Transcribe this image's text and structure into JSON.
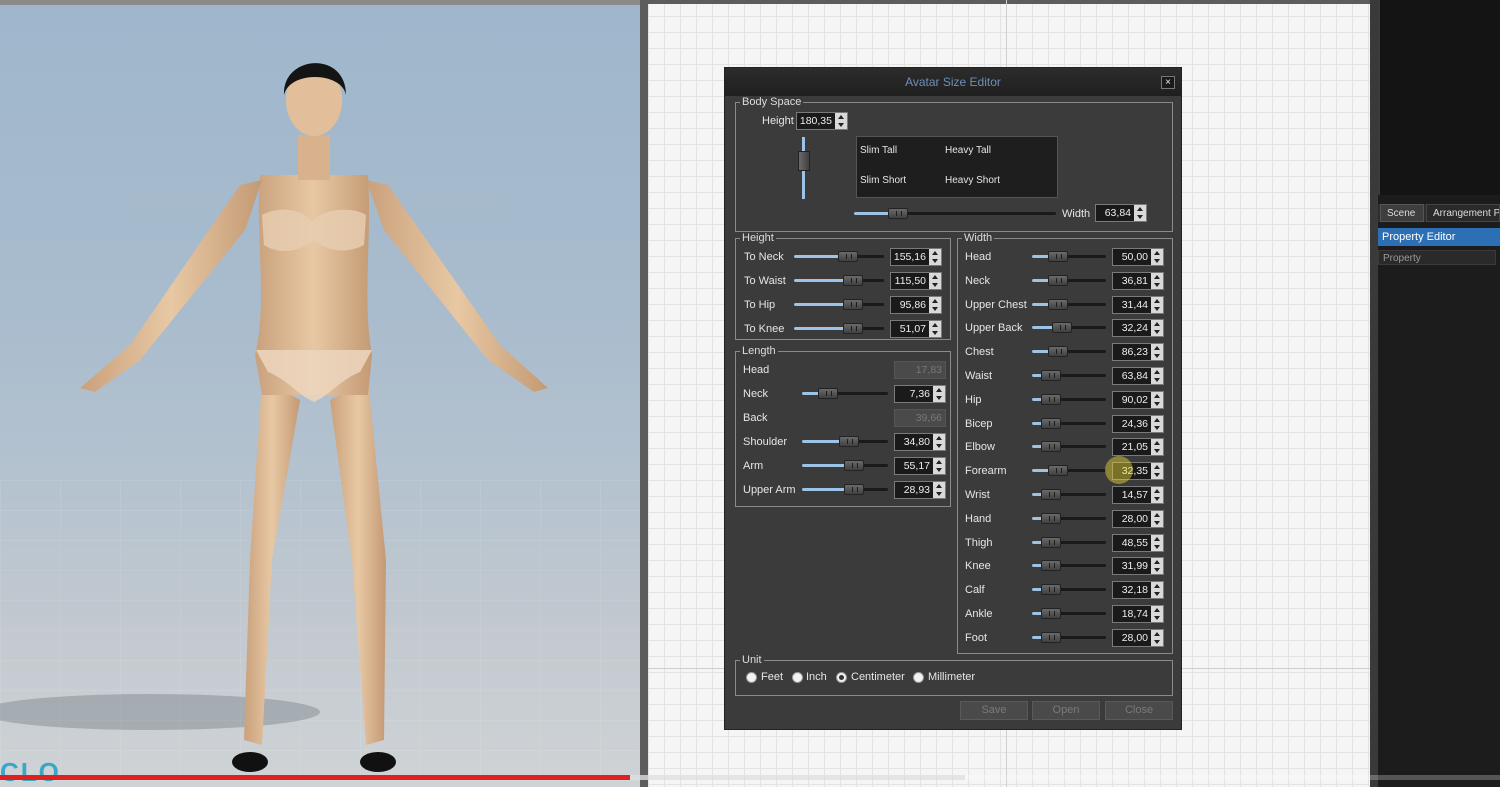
{
  "dialog": {
    "title": "Avatar Size Editor",
    "close_label": "×",
    "body_space": {
      "label": "Body Space",
      "height_label": "Height",
      "height_value": "180,35",
      "presets": [
        "Slim Tall",
        "Heavy Tall",
        "Slim Short",
        "Heavy Short"
      ],
      "width_label": "Width",
      "width_value": "63,84"
    },
    "height_group": {
      "label": "Height",
      "rows": [
        {
          "label": "To Neck",
          "value": "155,16",
          "level": 0.6
        },
        {
          "label": "To Waist",
          "value": "115,50",
          "level": 0.65
        },
        {
          "label": "To Hip",
          "value": "95,86",
          "level": 0.65
        },
        {
          "label": "To Knee",
          "value": "51,07",
          "level": 0.65
        }
      ]
    },
    "length_group": {
      "label": "Length",
      "rows": [
        {
          "label": "Head",
          "value": "17,83",
          "slider": false
        },
        {
          "label": "Neck",
          "value": "7,36",
          "slider": true,
          "level": 0.3
        },
        {
          "label": "Back",
          "value": "39,66",
          "slider": false
        },
        {
          "label": "Shoulder",
          "value": "34,80",
          "slider": true,
          "level": 0.55
        },
        {
          "label": "Arm",
          "value": "55,17",
          "slider": true,
          "level": 0.6
        },
        {
          "label": "Upper Arm",
          "value": "28,93",
          "slider": true,
          "level": 0.6
        }
      ]
    },
    "width_group": {
      "label": "Width",
      "rows": [
        {
          "label": "Head",
          "value": "50,00",
          "level": 0.35
        },
        {
          "label": "Neck",
          "value": "36,81",
          "level": 0.35
        },
        {
          "label": "Upper Chest",
          "value": "31,44",
          "level": 0.35
        },
        {
          "label": "Upper Back",
          "value": "32,24",
          "level": 0.4
        },
        {
          "label": "Chest",
          "value": "86,23",
          "level": 0.35
        },
        {
          "label": "Waist",
          "value": "63,84",
          "level": 0.25
        },
        {
          "label": "Hip",
          "value": "90,02",
          "level": 0.25
        },
        {
          "label": "Bicep",
          "value": "24,36",
          "level": 0.25
        },
        {
          "label": "Elbow",
          "value": "21,05",
          "level": 0.25
        },
        {
          "label": "Forearm",
          "value": "32,35",
          "level": 0.35
        },
        {
          "label": "Wrist",
          "value": "14,57",
          "level": 0.25
        },
        {
          "label": "Hand",
          "value": "28,00",
          "level": 0.25
        },
        {
          "label": "Thigh",
          "value": "48,55",
          "level": 0.25
        },
        {
          "label": "Knee",
          "value": "31,99",
          "level": 0.25
        },
        {
          "label": "Calf",
          "value": "32,18",
          "level": 0.25
        },
        {
          "label": "Ankle",
          "value": "18,74",
          "level": 0.25
        },
        {
          "label": "Foot",
          "value": "28,00",
          "level": 0.25
        }
      ]
    },
    "unit": {
      "label": "Unit",
      "options": [
        "Feet",
        "Inch",
        "Centimeter",
        "Millimeter"
      ],
      "selected": "Centimeter"
    },
    "buttons": {
      "save": "Save",
      "open": "Open",
      "close": "Close"
    }
  },
  "right_panel": {
    "tabs": [
      "Scene",
      "Arrangement P"
    ],
    "property_editor": "Property Editor",
    "property_column": "Property"
  },
  "logo_text": "CLO",
  "video_progress": {
    "played": 0.42,
    "loaded": 0.643
  },
  "colors": {
    "accent": "#2c6fb4",
    "slider_fill": "#9dc3e6",
    "progress": "#e0201f"
  }
}
